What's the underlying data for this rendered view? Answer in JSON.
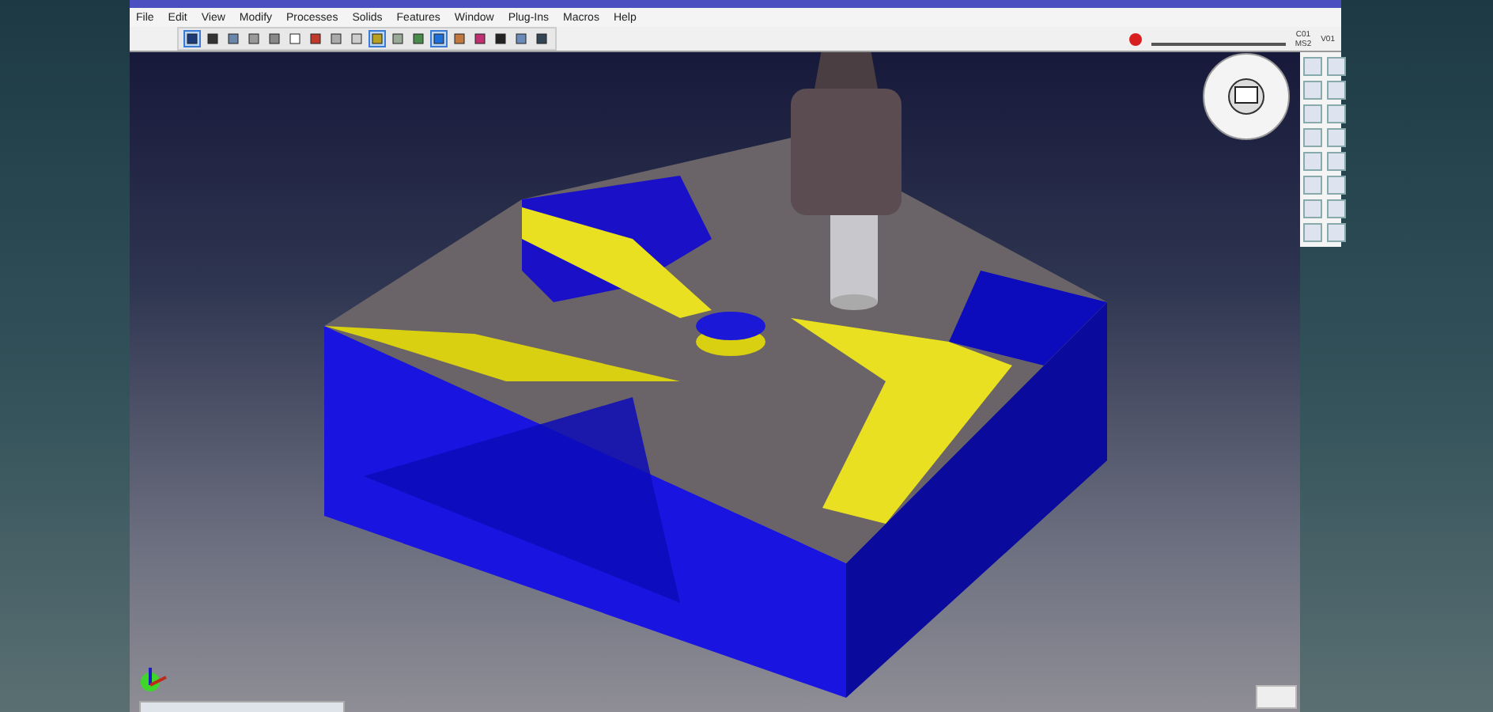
{
  "menu": [
    "File",
    "Edit",
    "View",
    "Modify",
    "Processes",
    "Solids",
    "Features",
    "Window",
    "Plug-Ins",
    "Macros",
    "Help"
  ],
  "toolbar_tools": [
    {
      "selected": true
    },
    {
      "selected": false
    },
    {
      "selected": false
    },
    {
      "selected": false
    },
    {
      "selected": false
    },
    {
      "selected": false
    },
    {
      "selected": false
    },
    {
      "selected": false
    },
    {
      "selected": false
    },
    {
      "selected": true
    },
    {
      "selected": false
    },
    {
      "selected": false
    },
    {
      "selected": true
    },
    {
      "selected": false
    },
    {
      "selected": false
    },
    {
      "selected": false
    },
    {
      "selected": false
    },
    {
      "selected": false
    }
  ],
  "status": {
    "cycle": "C01",
    "view": "V01",
    "machine": "MS2"
  }
}
